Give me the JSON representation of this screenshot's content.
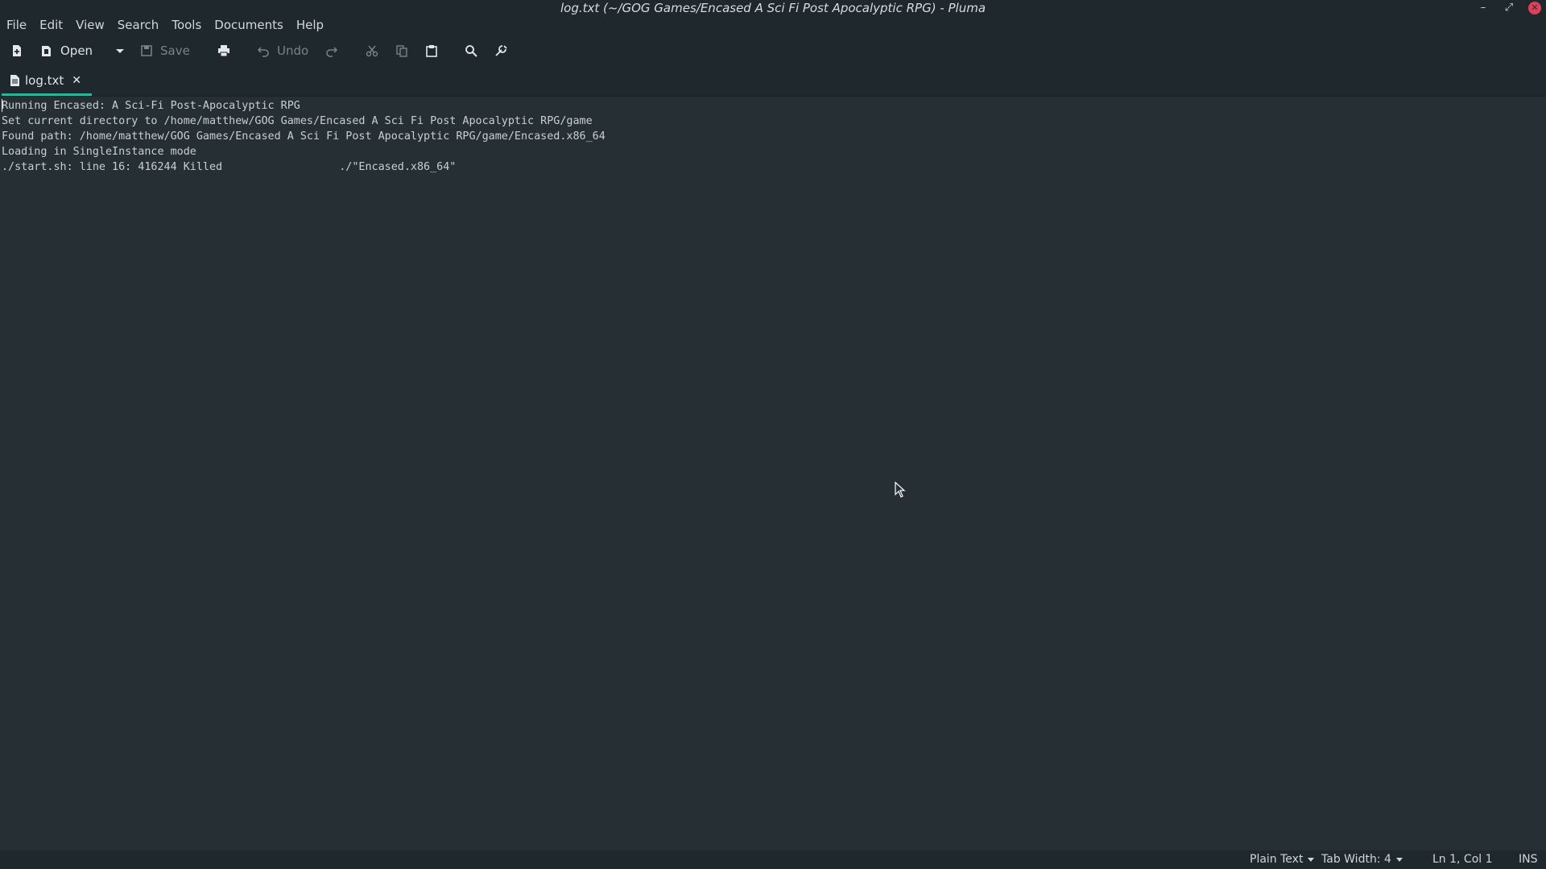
{
  "window": {
    "title": "log.txt (~/GOG Games/Encased A Sci Fi Post Apocalyptic RPG) - Pluma",
    "minimize_icon": "minimize-icon",
    "maximize_icon": "maximize-icon",
    "close_icon": "close-icon"
  },
  "menubar": {
    "items": [
      "File",
      "Edit",
      "View",
      "Search",
      "Tools",
      "Documents",
      "Help"
    ]
  },
  "toolbar": {
    "new_icon": "new-document-icon",
    "open_label": "Open",
    "save_label": "Save",
    "print_icon": "print-icon",
    "undo_label": "Undo",
    "redo_icon": "redo-icon",
    "cut_icon": "cut-icon",
    "copy_icon": "copy-icon",
    "paste_icon": "paste-icon",
    "search_icon": "search-icon",
    "replace_icon": "find-replace-icon"
  },
  "tabs": [
    {
      "label": "log.txt",
      "active": true
    }
  ],
  "editor": {
    "lines": [
      "Running Encased: A Sci-Fi Post-Apocalyptic RPG",
      "Set current directory to /home/matthew/GOG Games/Encased A Sci Fi Post Apocalyptic RPG/game",
      "Found path: /home/matthew/GOG Games/Encased A Sci Fi Post Apocalyptic RPG/game/Encased.x86_64",
      "Loading in SingleInstance mode",
      "./start.sh: line 16: 416244 Killed                  ./\"Encased.x86_64\""
    ]
  },
  "statusbar": {
    "language": "Plain Text",
    "tab_width": "Tab Width:  4",
    "position": "Ln 1, Col 1",
    "mode": "INS"
  },
  "colors": {
    "background": "#263034",
    "chrome": "#1f282c",
    "accent": "#2eb398",
    "close_button": "#e0405a"
  }
}
